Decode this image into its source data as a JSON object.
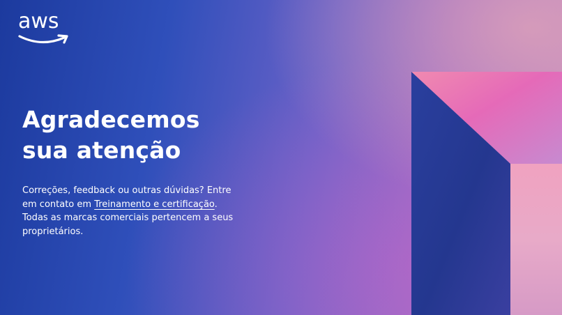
{
  "logo": {
    "text": "aws"
  },
  "title": {
    "line1": "Agradecemos",
    "line2": "sua atenção"
  },
  "body": {
    "line1": "Correções, feedback ou outras dúvidas?  Entre",
    "line2_prefix": "em contato em ",
    "link_label": "Treinamento e certificação",
    "line2_suffix": ".",
    "line3": "Todas as marcas comerciais pertencem a seus",
    "line4": "proprietários."
  },
  "colors": {
    "bg_left": "#1c3a9e",
    "bg_right": "#c08ac0",
    "shape_pink": "#e86bb6",
    "shape_blue": "#1d2f8e",
    "text": "#ffffff"
  }
}
